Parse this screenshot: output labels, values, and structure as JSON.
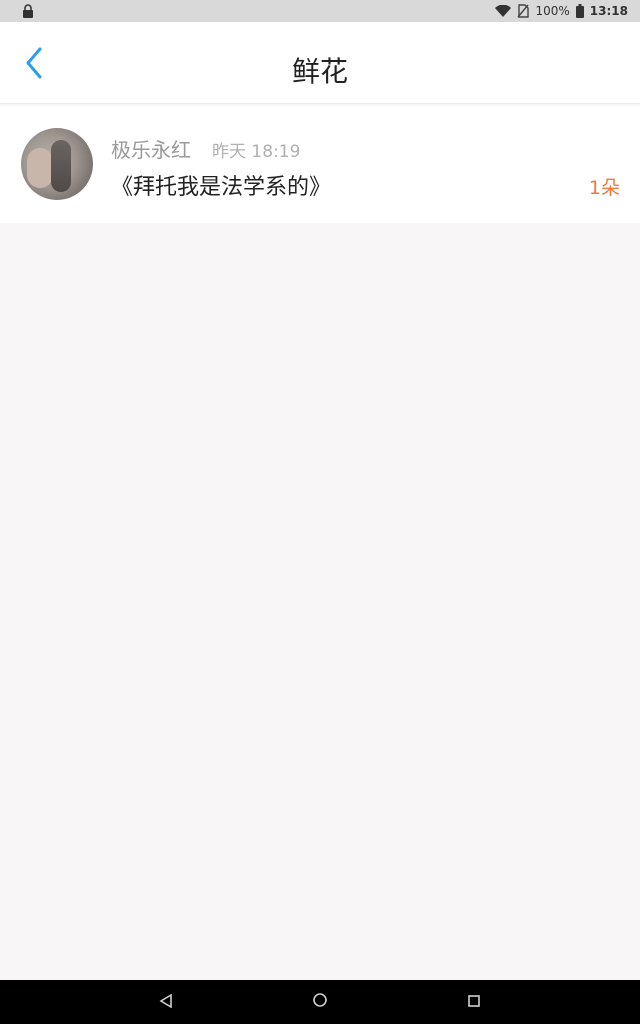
{
  "status_bar": {
    "battery_text": "100%",
    "time": "13:18",
    "icons": [
      "lock-icon",
      "wifi-icon",
      "no-sim-icon",
      "battery-icon"
    ]
  },
  "header": {
    "title": "鲜花",
    "back_icon": "chevron-left-icon",
    "accent_color": "#2a9df4"
  },
  "items": [
    {
      "username": "极乐永红",
      "timestamp": "昨天 18:19",
      "message": "《拜托我是法学系的》",
      "count": "1朵",
      "count_color": "#f07a3a"
    }
  ],
  "navigation": {
    "buttons": [
      "back-triangle-icon",
      "home-circle-icon",
      "recents-square-icon"
    ]
  }
}
